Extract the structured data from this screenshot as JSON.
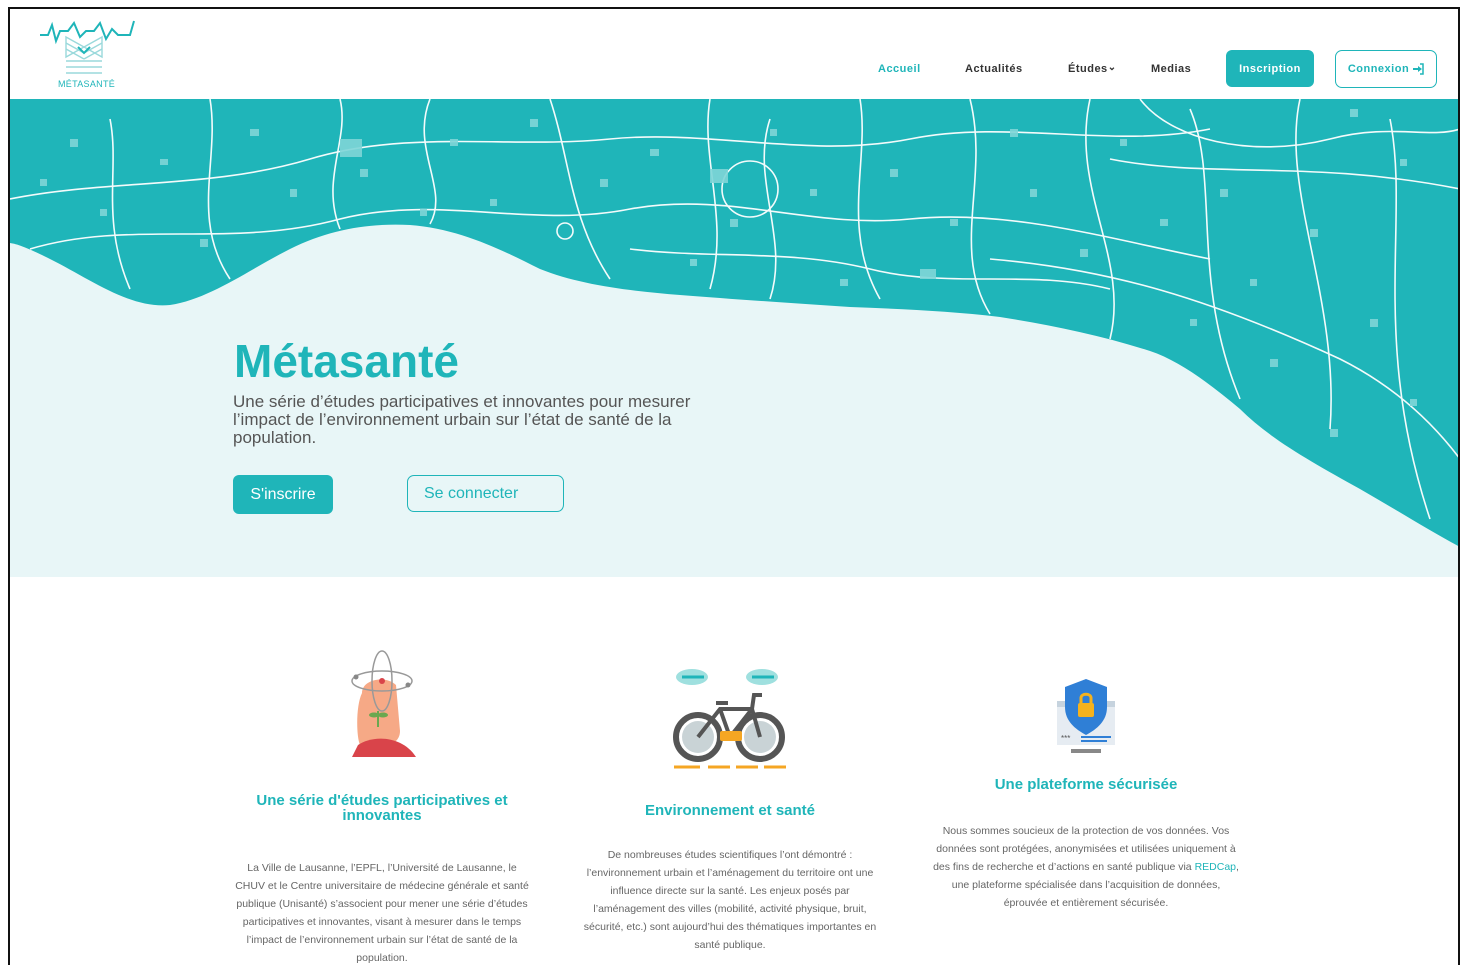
{
  "logo": {
    "text": "MÉTASANTÉ",
    "icon": "heartbeat-building-logo"
  },
  "nav": {
    "items": [
      {
        "label": "Accueil",
        "active": true
      },
      {
        "label": "Actualités",
        "active": false
      },
      {
        "label": "Études",
        "active": false
      },
      {
        "label": "Medias",
        "active": false
      }
    ],
    "etudes_chevron": "⌄",
    "inscription": "Inscription",
    "connexion": "Connexion",
    "connexion_icon": "login-icon"
  },
  "hero": {
    "title": "Métasanté",
    "subtitle": "Une série d’études participatives et innovantes pour mesurer l’impact de l’environnement urbain sur l’état de santé de la population.",
    "btn_primary": "S'inscrire",
    "btn_secondary": "Se connecter",
    "map_color": "#1fb5b9",
    "lake_color": "#e8f6f7"
  },
  "features": [
    {
      "icon": "head-plant-atom-icon",
      "title": "Une série d'études participatives et innovantes",
      "text": "La Ville de Lausanne, l’EPFL, l’Université de Lausanne, le CHUV et le Centre universitaire de médecine générale et santé publique (Unisanté) s’associent pour mener une série d’études participatives et innovantes, visant à mesurer dans le temps l’impact de l’environnement urbain sur l’état de santé de la population."
    },
    {
      "icon": "bicycle-icon",
      "title": "Environnement et santé",
      "text": "De nombreuses études scientifiques l’ont démontré : l’environnement urbain et l’aménagement du territoire ont une influence directe sur la santé. Les enjeux posés par l’aménagement des villes (mobilité, activité physique, bruit, sécurité, etc.) sont aujourd’hui des thématiques importantes en santé publique."
    },
    {
      "icon": "secure-platform-icon",
      "title": "Une plateforme sécurisée",
      "text_before": "Nous sommes soucieux de la protection de vos données. Vos données sont protégées, anonymisées et utilisées uniquement à des fins de recherche et d’actions en santé publique via ",
      "link": "REDCap",
      "text_after": ", une plateforme spécialisée dans l’acquisition de données, éprouvée et entièrement sécurisée."
    }
  ],
  "colors": {
    "accent": "#1fb5b9",
    "text": "#666666"
  }
}
